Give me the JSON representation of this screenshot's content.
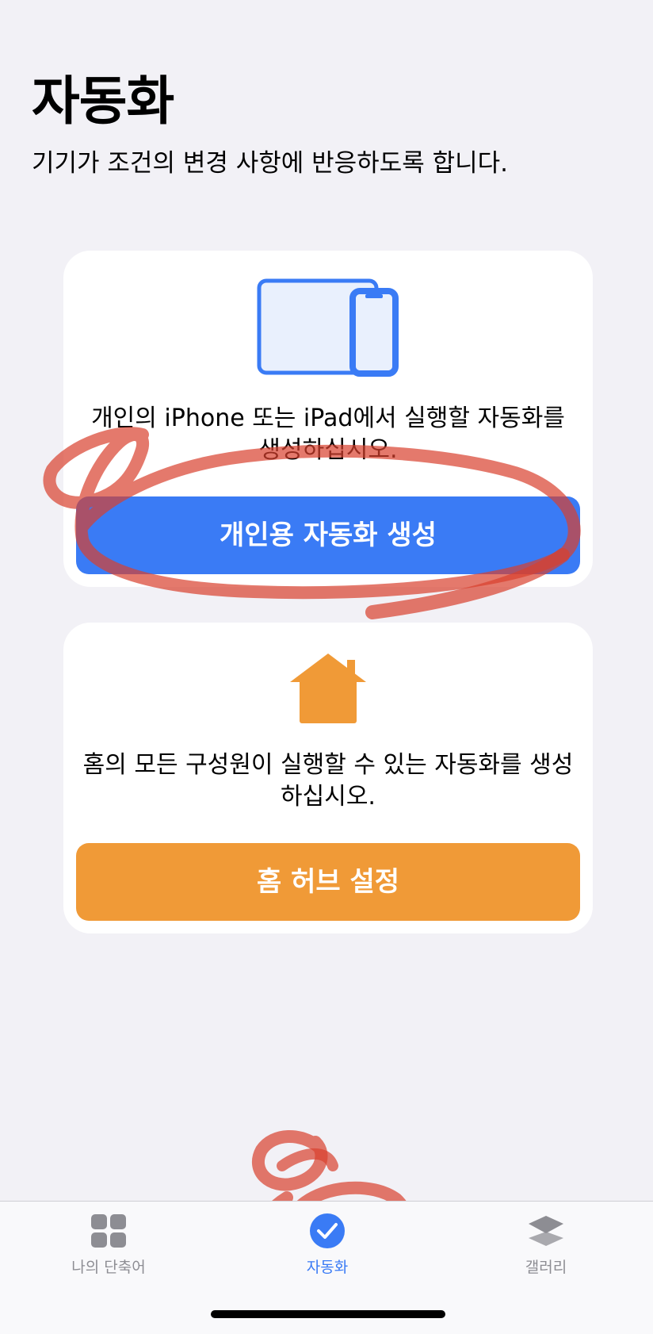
{
  "header": {
    "title": "자동화",
    "subtitle": "기기가 조건의 변경 사항에 반응하도록 합니다."
  },
  "personal_card": {
    "icon": "iphone-ipad-icon",
    "description": "개인의 iPhone 또는 iPad에서 실행할 자동화를 생성하십시오.",
    "button_label": "개인용 자동화 생성"
  },
  "home_card": {
    "icon": "house-icon",
    "description": "홈의 모든 구성원이 실행할 수 있는 자동화를 생성하십시오.",
    "button_label": "홈 허브 설정"
  },
  "tab_bar": {
    "tabs": [
      {
        "label": "나의 단축어",
        "icon": "grid-icon",
        "selected": false
      },
      {
        "label": "자동화",
        "icon": "checkmark-circle-icon",
        "selected": true
      },
      {
        "label": "갤러리",
        "icon": "stack-icon",
        "selected": false
      }
    ]
  },
  "colors": {
    "background": "#f2f1f6",
    "accent_blue": "#3a7bf5",
    "accent_orange": "#f09a37",
    "annotation_red": "#d9402e",
    "tab_inactive": "#8d8d93"
  }
}
